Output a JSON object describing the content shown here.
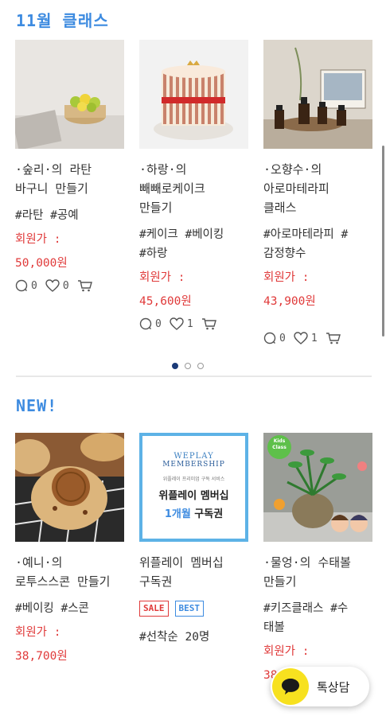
{
  "section1": {
    "title": "11월 클래스",
    "cards": [
      {
        "name_line1": "·숲리·의 라탄",
        "name_line2": "바구니 만들기",
        "name_line3": "",
        "tags": "#라탄 #공예",
        "tags2": "",
        "price_label": "회원가 :",
        "price": "50,000원",
        "comments": "0",
        "likes": "0",
        "image_icon": "rattan-basket-lemons-photo"
      },
      {
        "name_line1": "·하랑·의",
        "name_line2": "빼빼로케이크",
        "name_line3": "만들기",
        "tags": "#케이크 #베이킹",
        "tags2": "#하랑",
        "price_label": "회원가 :",
        "price": "45,600원",
        "comments": "0",
        "likes": "1",
        "image_icon": "pepero-cake-photo"
      },
      {
        "name_line1": "·오향수·의",
        "name_line2": "아로마테라피",
        "name_line3": "클래스",
        "tags": "#아로마테라피 #",
        "tags2": "감정향수",
        "price_label": "회원가 :",
        "price": "43,900원",
        "comments": "0",
        "likes": "1",
        "image_icon": "aroma-oil-bottles-photo"
      }
    ]
  },
  "section2": {
    "title": "NEW!",
    "cards": [
      {
        "name_line1": "·예니·의",
        "name_line2": "로투스스콘 만들기",
        "tags": "#베이킹 #스콘",
        "price_label": "회원가 :",
        "price": "38,700원",
        "image_icon": "lotus-scone-photo"
      },
      {
        "name_line1": "위플레이 멤버십",
        "name_line2": "구독권",
        "badge_sale": "SALE",
        "badge_best": "BEST",
        "tags": "#선착순 20명",
        "image_icon": "membership-card-image",
        "img_top": "WEPLAY",
        "img_mid": "MEMBERSHIP",
        "img_small": "위플레이 프리미엄 구독 서비스",
        "img_main": "위플레이 멤버십",
        "img_month": "1개월",
        "img_sub": " 구독권"
      },
      {
        "name_line1": "·물엉·의 수태볼",
        "name_line2": "만들기",
        "tags": "#키즈클래스 #수",
        "tags2": "태볼",
        "price_label": "회원가 :",
        "price": "38",
        "image_icon": "moss-ball-plant-photo",
        "kids_badge": "Kids Class"
      }
    ]
  },
  "chat": {
    "label": "톡상담"
  },
  "colors": {
    "accent": "#3d8be0",
    "price": "#e03a3a",
    "kakao": "#f7e11f"
  }
}
